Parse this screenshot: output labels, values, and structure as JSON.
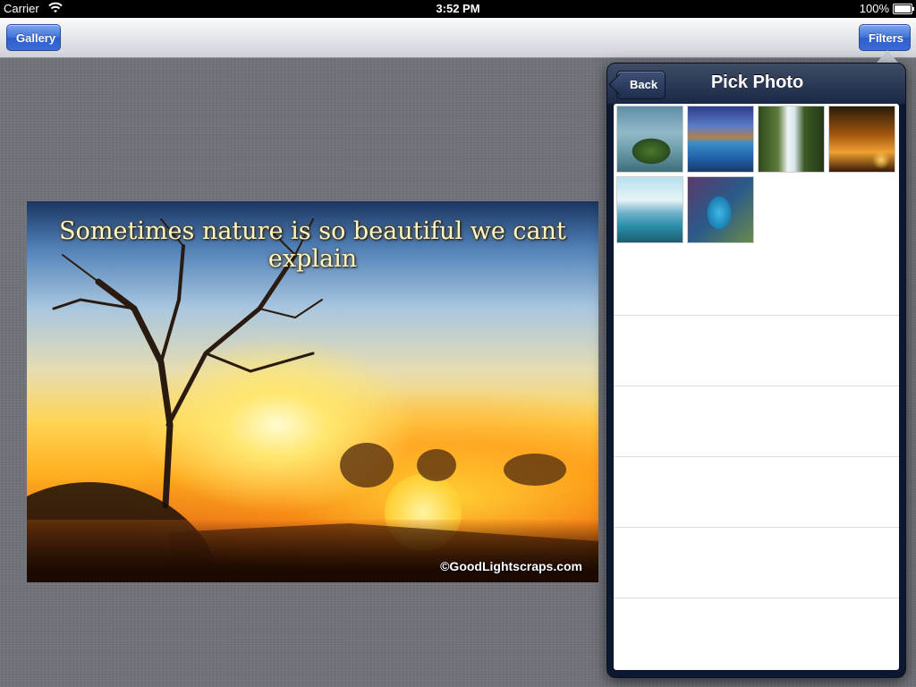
{
  "status_bar": {
    "carrier": "Carrier",
    "time": "3:52 PM",
    "battery": "100%"
  },
  "toolbar": {
    "left_button": "Gallery",
    "right_button": "Filters"
  },
  "photo": {
    "headline": "Sometimes nature is so beautiful we cant explain",
    "credit": "©GoodLightscraps.com"
  },
  "popover": {
    "back_label": "Back",
    "title": "Pick Photo",
    "thumbnails": [
      "Island tree thumbnail",
      "Blue lake thumbnail",
      "Waterfall thumbnail",
      "Sunset thumbnail",
      "Frozen lake thumbnail",
      "Blue face art thumbnail"
    ]
  },
  "colors": {
    "button_blue": "#3f71d8",
    "popover_navy": "#1c2945",
    "linen": "#6e7278"
  }
}
